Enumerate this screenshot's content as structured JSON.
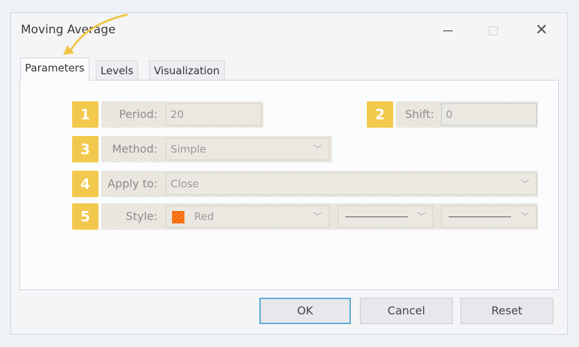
{
  "window": {
    "title": "Moving Average",
    "minimize_icon": "minimize-icon",
    "maximize_icon": "maximize-icon",
    "close_icon": "close-icon",
    "close_glyph": "✕"
  },
  "tabs": [
    {
      "label": "Parameters",
      "active": true
    },
    {
      "label": "Levels",
      "active": false
    },
    {
      "label": "Visualization",
      "active": false
    }
  ],
  "params": {
    "period": {
      "badge": "1",
      "label": "Period:",
      "value": "20"
    },
    "shift": {
      "badge": "2",
      "label": "Shift:",
      "value": "0"
    },
    "method": {
      "badge": "3",
      "label": "Method:",
      "value": "Simple"
    },
    "apply_to": {
      "badge": "4",
      "label": "Apply to:",
      "value": "Close"
    },
    "style": {
      "badge": "5",
      "label": "Style:",
      "color_name": "Red",
      "color_hex": "#ff7a1a"
    }
  },
  "buttons": {
    "ok": "OK",
    "cancel": "Cancel",
    "reset": "Reset"
  },
  "colors": {
    "badge": "#f2c94c",
    "accent": "#5aa9d6"
  }
}
